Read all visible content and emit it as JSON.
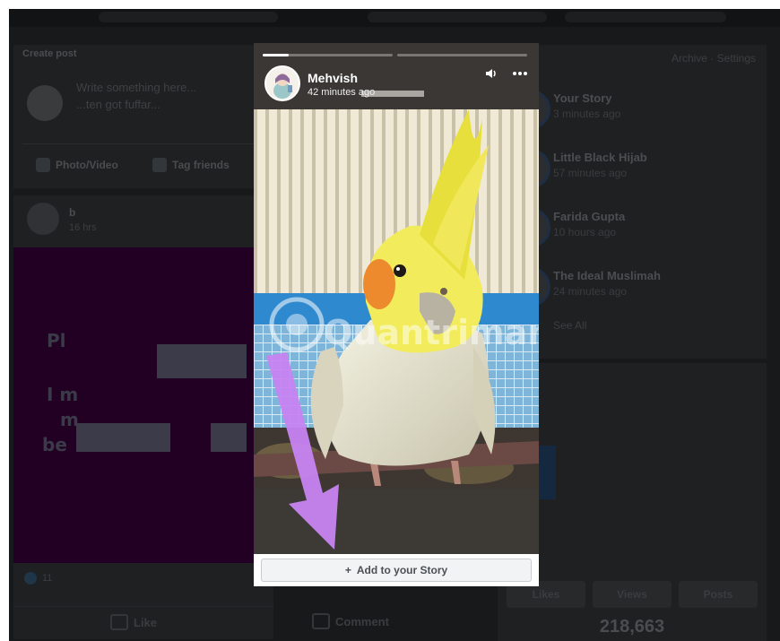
{
  "background_page": {
    "create_post": {
      "title": "Create post",
      "placeholder_line1": "Write something here...",
      "placeholder_line2": "...ten got fuffar...",
      "photo_video_label": "Photo/Video",
      "tag_friends_label": "Tag friends"
    },
    "post": {
      "author": "b",
      "time": "16 hrs",
      "text_fragments": [
        "Pl",
        "I m",
        "m",
        "be"
      ],
      "reaction_count": "11",
      "like_label": "Like",
      "comment_label": "Comment"
    },
    "stories": {
      "archive_label": "Archive",
      "settings_label": "Settings",
      "items": [
        {
          "name": "Your Story",
          "time": "3 minutes ago"
        },
        {
          "name": "Little Black Hijab",
          "time": "57 minutes ago"
        },
        {
          "name": "Farida Gupta",
          "time": "10 hours ago"
        },
        {
          "name": "The Ideal Muslimah",
          "time": "24 minutes ago"
        }
      ],
      "see_all_label": "See All"
    },
    "insights": {
      "tabs": [
        "Likes",
        "Views",
        "Posts"
      ],
      "number": "218,663"
    }
  },
  "story_viewer": {
    "user_name": "Mehvish",
    "time": "42 minutes ago",
    "volume_icon": "speaker-icon",
    "more_icon": "more-horizontal-icon",
    "progress_segments": [
      0.2,
      0
    ],
    "add_to_story_label": "Add to your Story",
    "add_icon": "+",
    "watermark": "Quantrimang"
  },
  "colors": {
    "accent_arrow": "#c784f2",
    "modal_bg": "#ffffff",
    "dim_overlay": "#18191a"
  }
}
